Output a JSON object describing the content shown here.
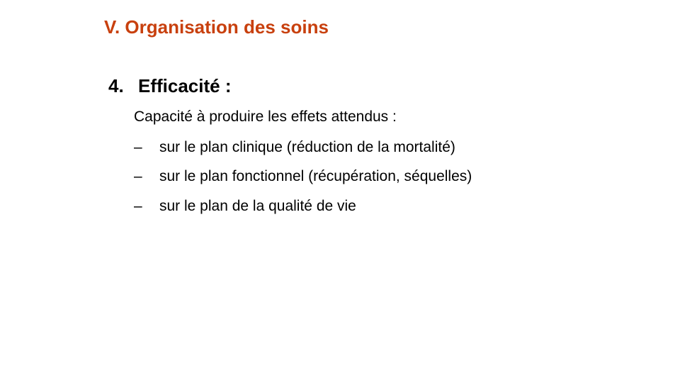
{
  "slide": {
    "title": "V. Organisation des soins",
    "section": {
      "number": "4.",
      "heading": "Efficacité :"
    },
    "intro": "Capacité à produire les effets attendus :",
    "bullets": [
      {
        "dash": "–",
        "text": "sur le plan clinique (réduction de la mortalité)"
      },
      {
        "dash": "–",
        "text": "sur le plan fonctionnel (récupération, séquelles)"
      },
      {
        "dash": "–",
        "text": "sur le plan de la qualité de vie"
      }
    ],
    "colors": {
      "title": "#c8400e",
      "text": "#000000",
      "background": "#ffffff"
    }
  }
}
